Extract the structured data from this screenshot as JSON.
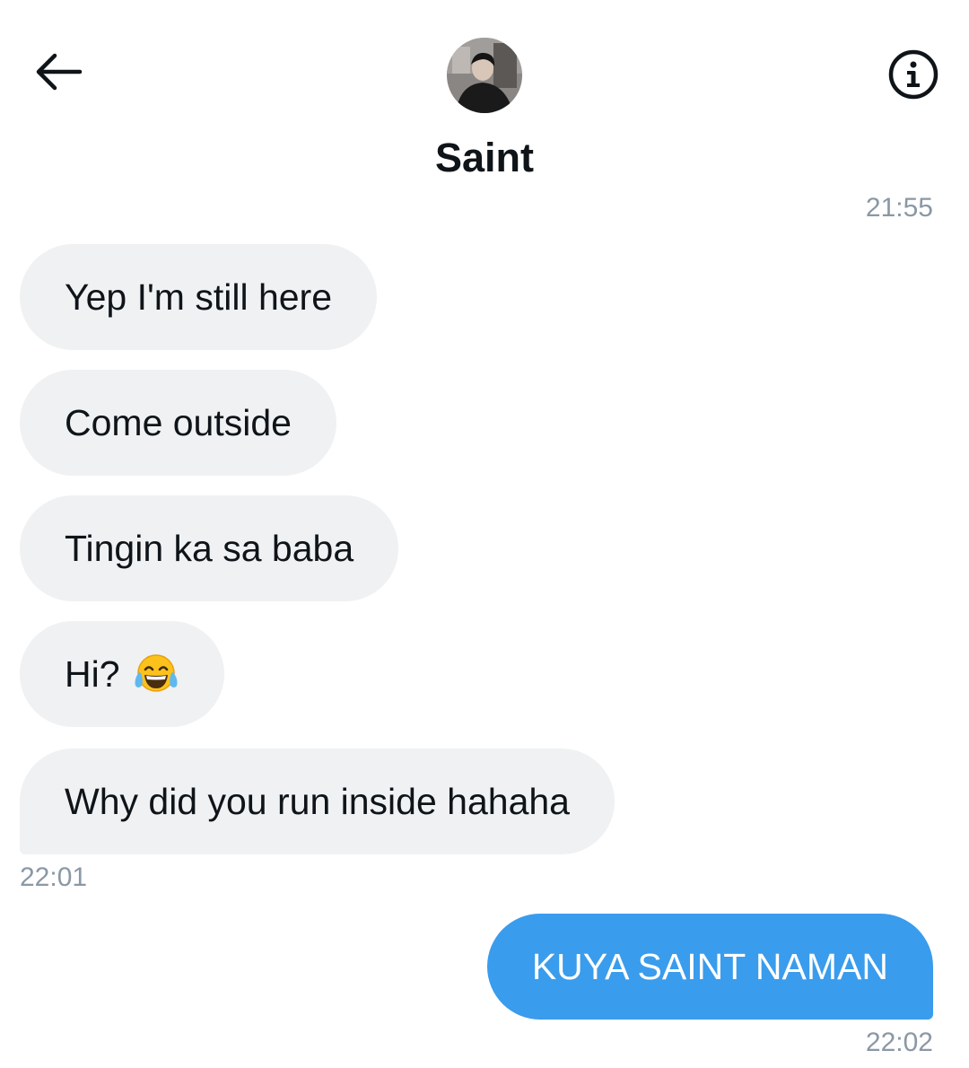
{
  "header": {
    "back_icon": "arrow-left-icon",
    "info_icon": "info-circle-icon",
    "contact_name": "Saint"
  },
  "conversation": {
    "timestamp_first": "21:55",
    "incoming": [
      {
        "text": "Yep I'm still here"
      },
      {
        "text": "Come outside"
      },
      {
        "text": "Tingin ka sa baba"
      },
      {
        "text": "Hi?",
        "emoji": "face-with-tears-of-joy-icon"
      },
      {
        "text": "Why did you run inside hahaha"
      }
    ],
    "incoming_timestamp": "22:01",
    "outgoing": [
      {
        "text": "KUYA SAINT NAMAN"
      }
    ],
    "outgoing_timestamp": "22:02"
  },
  "colors": {
    "incoming_bubble": "#eff1f3",
    "outgoing_bubble": "#3a9cec",
    "timestamp": "#8b98a5"
  }
}
